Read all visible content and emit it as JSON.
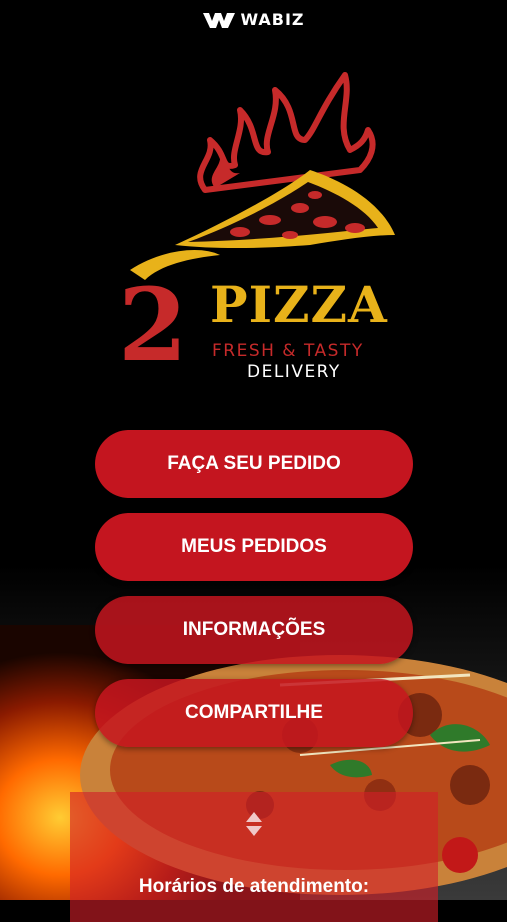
{
  "header": {
    "app_brand": "WABIZ",
    "logo_icon": "wabiz-logo-icon"
  },
  "brand": {
    "number": "2",
    "name": "PIZZA",
    "tagline": "FRESH & TASTY",
    "service": "DELIVERY",
    "colors": {
      "yellow": "#e8b21a",
      "red": "#c62a2a"
    }
  },
  "menu": {
    "items": [
      {
        "label": "FAÇA SEU PEDIDO"
      },
      {
        "label": "MEUS PEDIDOS"
      },
      {
        "label": "INFORMAÇÕES"
      },
      {
        "label": "COMPARTILHE"
      }
    ],
    "button_color": "#c4151f"
  },
  "info": {
    "toggle_icon": "up-down-arrows-icon",
    "hours_title": "Horários de atendimento:"
  }
}
